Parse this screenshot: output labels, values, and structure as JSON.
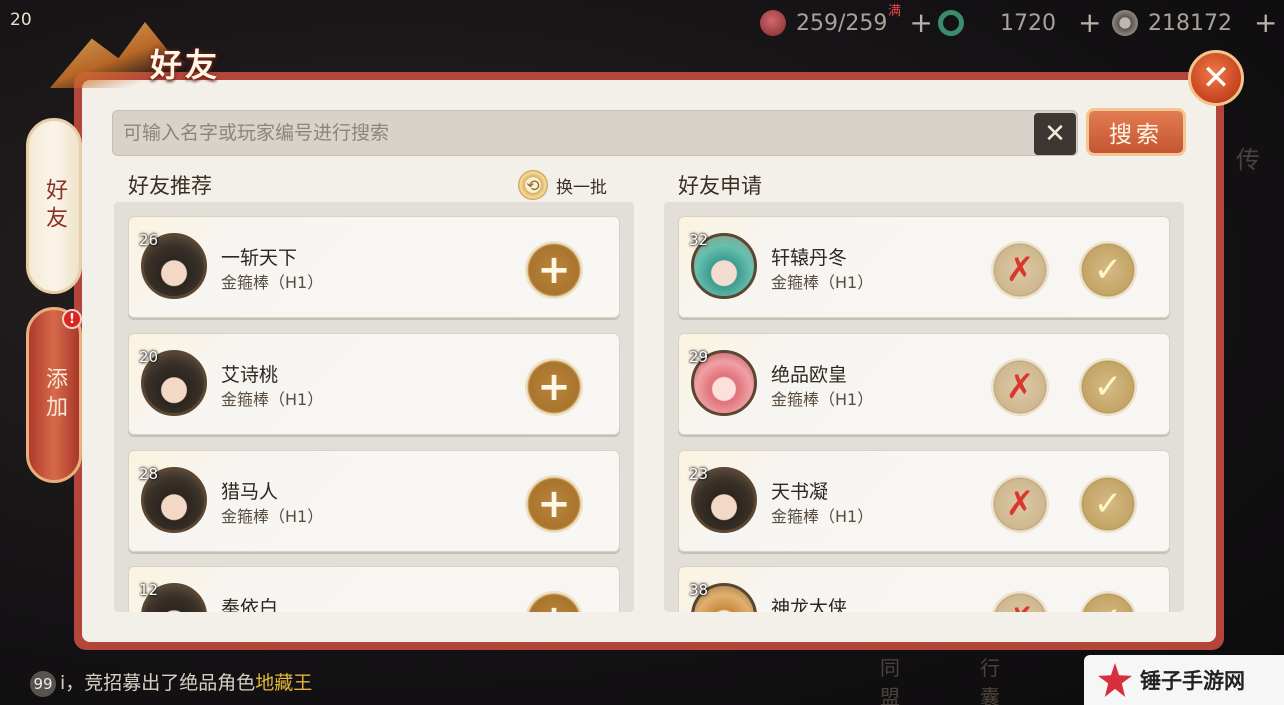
{
  "hud": {
    "level": "20",
    "stamina": "259/259",
    "stamina_full_tag": "满",
    "jade": "1720",
    "coins": "218172",
    "plus": "+"
  },
  "panel": {
    "title": "好友",
    "close": "✕"
  },
  "side_tabs": [
    {
      "label": "好友",
      "active": true
    },
    {
      "label": "添加",
      "active": false,
      "alert": "!"
    }
  ],
  "search": {
    "placeholder": "可输入名字或玩家编号进行搜索",
    "value": "",
    "clear": "✕",
    "button_label": "搜索"
  },
  "recommend": {
    "title": "好友推荐",
    "refresh_label": "换一批",
    "add_symbol": "+",
    "items": [
      {
        "level": "26",
        "name": "一斩天下",
        "server": "金箍棒（H1）"
      },
      {
        "level": "20",
        "name": "艾诗桃",
        "server": "金箍棒（H1）"
      },
      {
        "level": "28",
        "name": "猎马人",
        "server": "金箍棒（H1）"
      },
      {
        "level": "12",
        "name": "奉依白",
        "server": ""
      }
    ]
  },
  "requests": {
    "title": "好友申请",
    "reject_symbol": "✗",
    "accept_symbol": "✓",
    "items": [
      {
        "level": "32",
        "name": "轩辕丹冬",
        "server": "金箍棒（H1）"
      },
      {
        "level": "29",
        "name": "绝品欧皇",
        "server": "金箍棒（H1）"
      },
      {
        "level": "23",
        "name": "天书凝",
        "server": "金箍棒（H1）"
      },
      {
        "level": "38",
        "name": "神龙大侠",
        "server": ""
      }
    ]
  },
  "chat": {
    "count": "99",
    "text": "i，竞招募出了绝品角色",
    "highlight": "地藏王"
  },
  "background_labels": {
    "legend": "传",
    "alliance": "同\n盟",
    "bag": "行\n囊"
  },
  "watermark": {
    "text": "锤子手游网"
  }
}
